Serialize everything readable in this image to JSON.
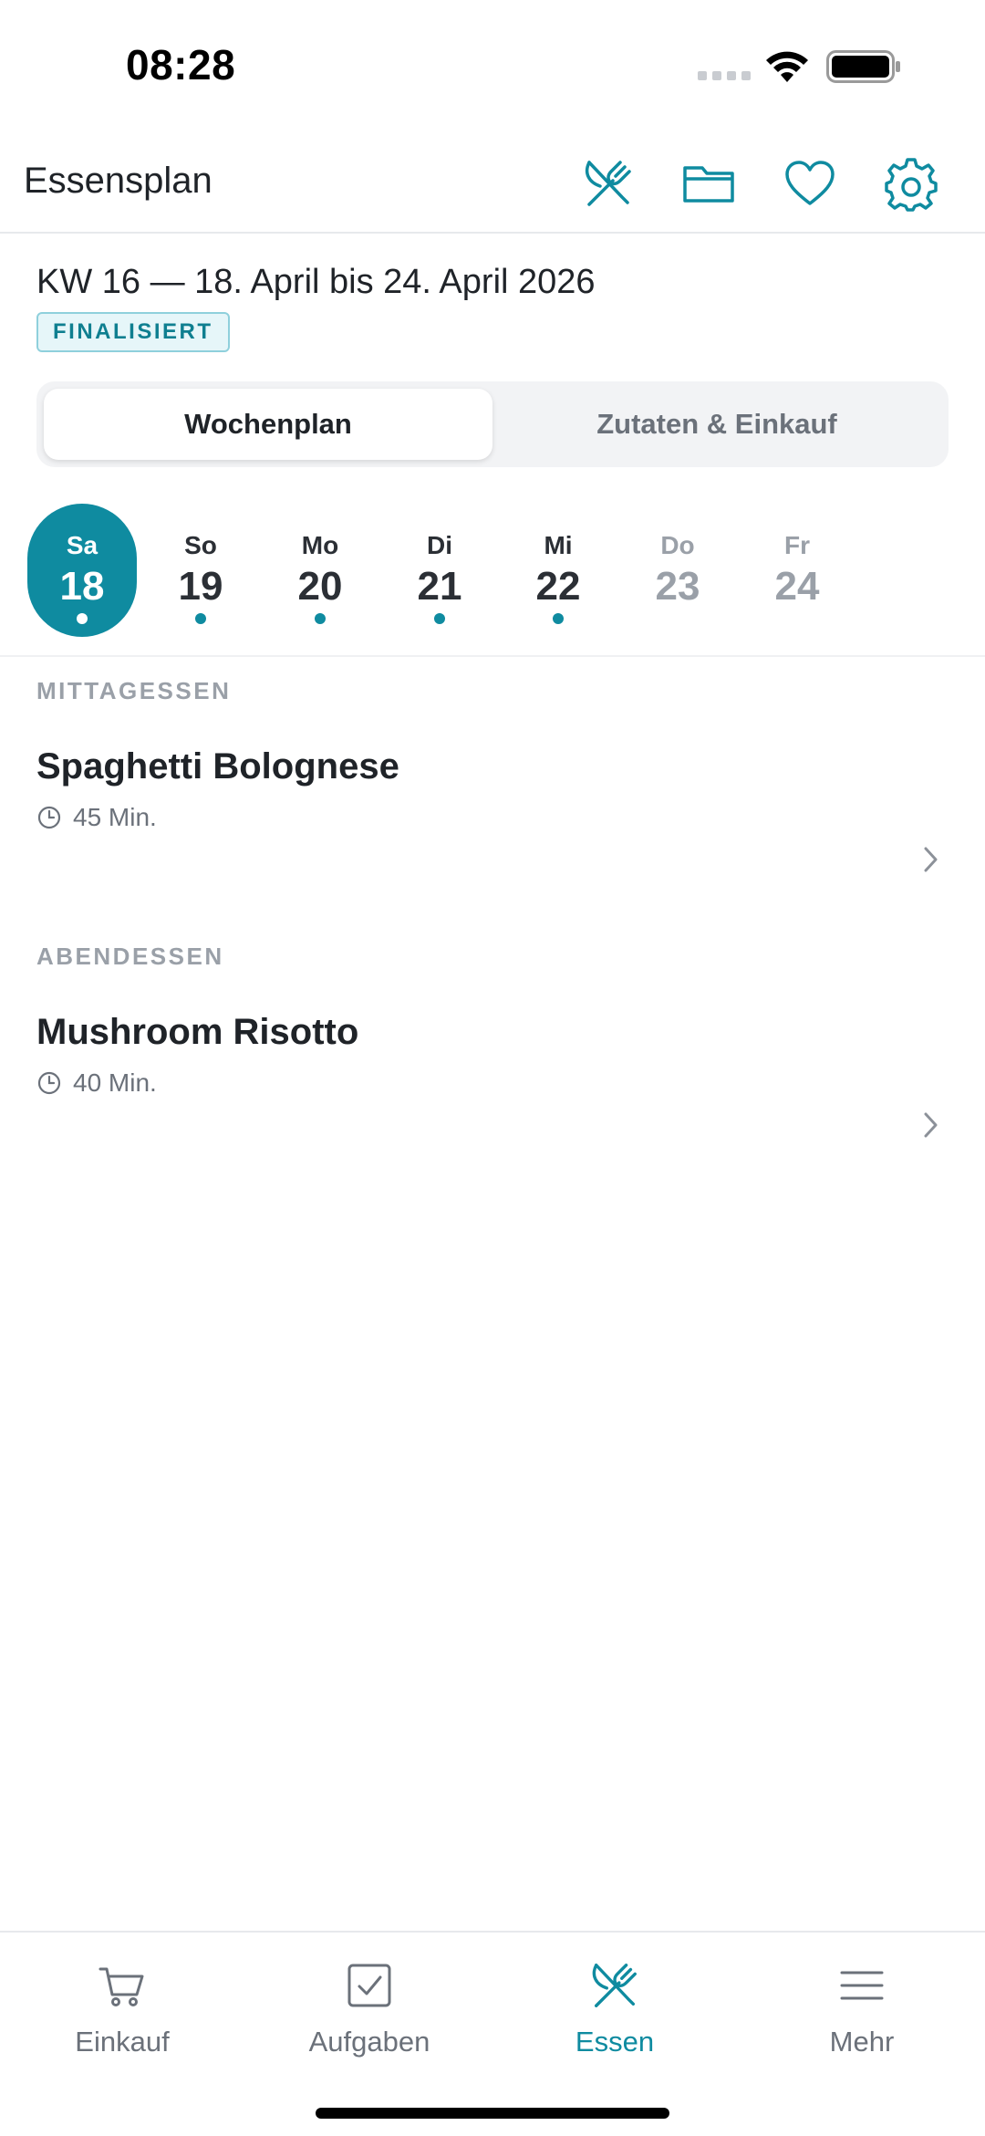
{
  "status": {
    "time": "08:28"
  },
  "header": {
    "title": "Essensplan"
  },
  "week": {
    "title": "KW 16 — 18. April bis 24. April 2026",
    "badge": "FINALISIERT"
  },
  "segments": [
    {
      "label": "Wochenplan",
      "active": true
    },
    {
      "label": "Zutaten & Einkauf",
      "active": false
    }
  ],
  "days": [
    {
      "name": "Sa",
      "num": "18"
    },
    {
      "name": "So",
      "num": "19"
    },
    {
      "name": "Mo",
      "num": "20"
    },
    {
      "name": "Di",
      "num": "21"
    },
    {
      "name": "Mi",
      "num": "22"
    },
    {
      "name": "Do",
      "num": "23"
    },
    {
      "name": "Fr",
      "num": "24"
    }
  ],
  "meals": [
    {
      "section": "MITTAGESSEN",
      "name": "Spaghetti Bolognese",
      "time": "45 Min."
    },
    {
      "section": "ABENDESSEN",
      "name": "Mushroom Risotto",
      "time": "40 Min."
    }
  ],
  "tabs": [
    {
      "label": "Einkauf",
      "icon": "cart-icon"
    },
    {
      "label": "Aufgaben",
      "icon": "checkbox-icon"
    },
    {
      "label": "Essen",
      "icon": "fork-knife-icon"
    },
    {
      "label": "Mehr",
      "icon": "menu-icon"
    }
  ],
  "colors": {
    "accent": "#0f8ba0",
    "muted": "#9aa0a8"
  }
}
